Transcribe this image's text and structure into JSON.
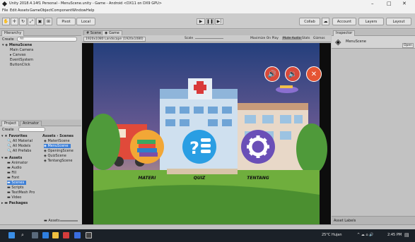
{
  "window": {
    "title": "Unity 2018.4.14f1 Personal - MenuScene.unity - Game - Android <DX11 on DX9 GPU>",
    "controls": [
      "–",
      "□",
      "✕"
    ]
  },
  "menubar": [
    "File",
    "Edit",
    "Assets",
    "GameObject",
    "Component",
    "Window",
    "Help"
  ],
  "toolbar": {
    "pivot_label": "Pivot",
    "local_label": "Local",
    "collab_label": "Collab",
    "account_label": "Account",
    "layers_label": "Layers",
    "layout_label": "Layout"
  },
  "hierarchy": {
    "tab_label": "Hierarchy",
    "create_label": "Create",
    "search_placeholder": "All",
    "scene_name": "MenuScene",
    "items": [
      "Main Camera",
      "Canvas",
      "EventSystem",
      "ButtonClick"
    ]
  },
  "scene_tabs": {
    "scene_label": "Scene",
    "game_label": "Game",
    "aspect_label": "1920x1080 Landscape (1920x1080)",
    "scale_label": "Scale",
    "options": [
      "Maximize On Play",
      "Mute Audio",
      "Stats",
      "Gizmos"
    ]
  },
  "inspector": {
    "tab_label": "Inspector",
    "object_name": "MenuScene",
    "open_label": "Open"
  },
  "project": {
    "tab_label": "Project",
    "tab2_label": "Animator",
    "create_label": "Create",
    "favorites_label": "Favorites",
    "favorites": [
      "All Material",
      "All Models",
      "All Prefabs"
    ],
    "breadcrumb": "Assets › Scenes",
    "scenes": [
      "MateriScene",
      "MenuScene",
      "OpeningScene",
      "QuizScene",
      "TentangScene"
    ],
    "assets_label": "Assets",
    "asset_folders": [
      "Animator",
      "Audio",
      "Fill",
      "Font",
      "Scenes",
      "Scripts",
      "TextMesh Pro",
      "Video"
    ],
    "packages_label": "Packages",
    "footer_path": "Assets"
  },
  "game": {
    "menu_items": [
      {
        "label": "MATERI",
        "icon": "books-icon"
      },
      {
        "label": "QUIZ",
        "icon": "quiz-icon"
      },
      {
        "label": "TENTANG",
        "icon": "gear-icon"
      }
    ],
    "top_buttons": [
      "sound-on-icon",
      "sound-icon",
      "close-icon"
    ]
  },
  "asset_labels": "Asset Labels",
  "taskbar": {
    "weather": "25°C Hujan",
    "time": "2:45 PM"
  },
  "colors": {
    "sky": "#2c4a86",
    "grass": "#3f8a2f",
    "materi_circle": "#f2a736",
    "quiz_circle": "#2a9ee3",
    "tentang_circle": "#6a4fb7",
    "selection": "#3d7fd6"
  }
}
